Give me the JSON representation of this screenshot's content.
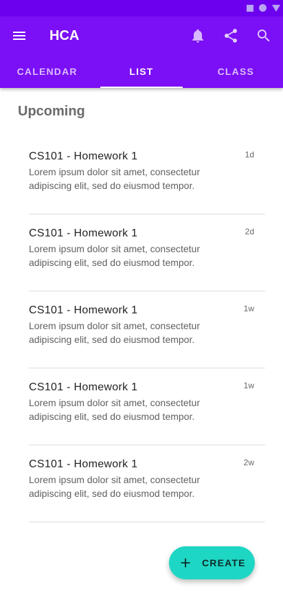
{
  "app": {
    "title": "HCA"
  },
  "tabs": [
    {
      "label": "CALENDAR",
      "active": false
    },
    {
      "label": "LIST",
      "active": true
    },
    {
      "label": "CLASS",
      "active": false
    }
  ],
  "section": {
    "title": "Upcoming"
  },
  "items": [
    {
      "title": "CS101 - Homework 1",
      "body": "Lorem ipsum dolor sit amet, consectetur adipiscing elit, sed do eiusmod tempor.",
      "time": "1d"
    },
    {
      "title": "CS101 - Homework 1",
      "body": "Lorem ipsum dolor sit amet, consectetur adipiscing elit, sed do eiusmod tempor.",
      "time": "2d"
    },
    {
      "title": "CS101 - Homework 1",
      "body": "Lorem ipsum dolor sit amet, consectetur adipiscing elit, sed do eiusmod tempor.",
      "time": "1w"
    },
    {
      "title": "CS101 - Homework 1",
      "body": "Lorem ipsum dolor sit amet, consectetur adipiscing elit, sed do eiusmod tempor.",
      "time": "1w"
    },
    {
      "title": "CS101 - Homework 1",
      "body": "Lorem ipsum dolor sit amet, consectetur adipiscing elit, sed do eiusmod tempor.",
      "time": "2w"
    }
  ],
  "fab": {
    "label": "CREATE",
    "icon": "plus-icon"
  },
  "icons": {
    "menu": "menu-icon",
    "notifications": "bell-icon",
    "share": "share-icon",
    "search": "search-icon",
    "status": [
      "square-icon",
      "circle-icon",
      "triangle-icon"
    ]
  },
  "colors": {
    "primary": "#7b0ff5",
    "status_bar": "#6c00ee",
    "accent": "#1ed6c4"
  }
}
